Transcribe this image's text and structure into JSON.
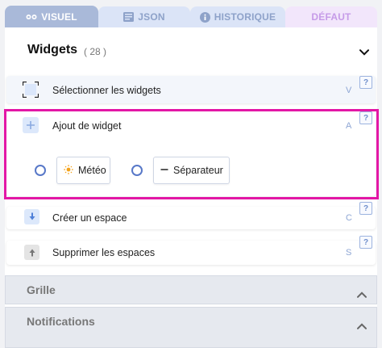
{
  "tabs": [
    {
      "label": "VISUEL",
      "icon": "eye-icon",
      "active": true
    },
    {
      "label": "JSON",
      "icon": "json-icon"
    },
    {
      "label": "HISTORIQUE",
      "icon": "info-icon"
    },
    {
      "label": "DÉFAUT"
    }
  ],
  "widgets": {
    "title": "Widgets",
    "count": "( 28 )"
  },
  "rows": {
    "select": {
      "label": "Sélectionner les widgets",
      "shortcut": "V",
      "help": "?"
    },
    "add": {
      "label": "Ajout de widget",
      "shortcut": "A",
      "help": "?",
      "options": [
        {
          "label": "Météo",
          "icon": "sun-icon"
        },
        {
          "label": "Séparateur",
          "icon": "minus-icon"
        }
      ]
    },
    "create": {
      "label": "Créer un espace",
      "shortcut": "C",
      "help": "?"
    },
    "delete": {
      "label": "Supprimer les espaces",
      "shortcut": "S",
      "help": "?"
    }
  },
  "sections": {
    "grille": "Grille",
    "notifications": "Notifications"
  },
  "colors": {
    "accent": "#5878c8",
    "highlight": "#e317a6",
    "tab_active": "#a9b9d9"
  }
}
